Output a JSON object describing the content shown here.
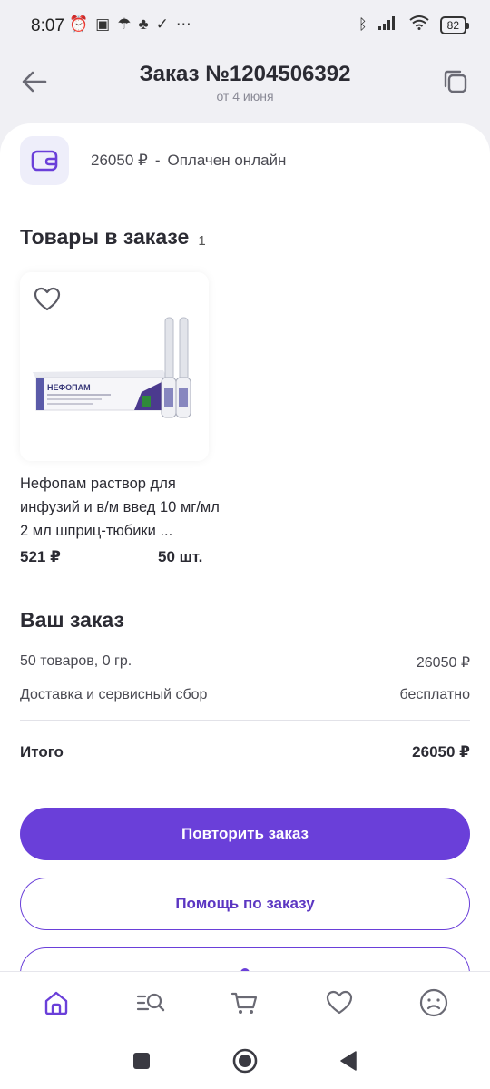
{
  "status_bar": {
    "time": "8:07",
    "battery": "82"
  },
  "header": {
    "title": "Заказ №1204506392",
    "date": "от 4 июня"
  },
  "payment": {
    "amount": "26050 ₽",
    "separator": "-",
    "status": "Оплачен онлайн",
    "icon": "wallet-icon"
  },
  "goods": {
    "title": "Товары в заказе",
    "count": "1",
    "items": [
      {
        "name": "Нефопам раствор для инфузий и в/м введ 10 мг/мл 2 мл шприц-тюбики ...",
        "price": "521 ₽",
        "qty": "50 шт.",
        "package_label": "НЕФОПАМ"
      }
    ]
  },
  "summary": {
    "title": "Ваш заказ",
    "items_label": "50 товаров, 0 гр.",
    "items_value": "26050 ₽",
    "delivery_label": "Доставка и сервисный сбор",
    "delivery_value": "бесплатно",
    "total_label": "Итого",
    "total_value": "26050 ₽"
  },
  "buttons": {
    "repeat": "Повторить заказ",
    "help": "Помощь по заказу"
  },
  "bottom_nav": [
    "home-icon",
    "catalog-search-icon",
    "cart-icon",
    "favorites-icon",
    "profile-icon"
  ],
  "colors": {
    "accent": "#6a3fd9",
    "background": "#f0f0f4"
  }
}
